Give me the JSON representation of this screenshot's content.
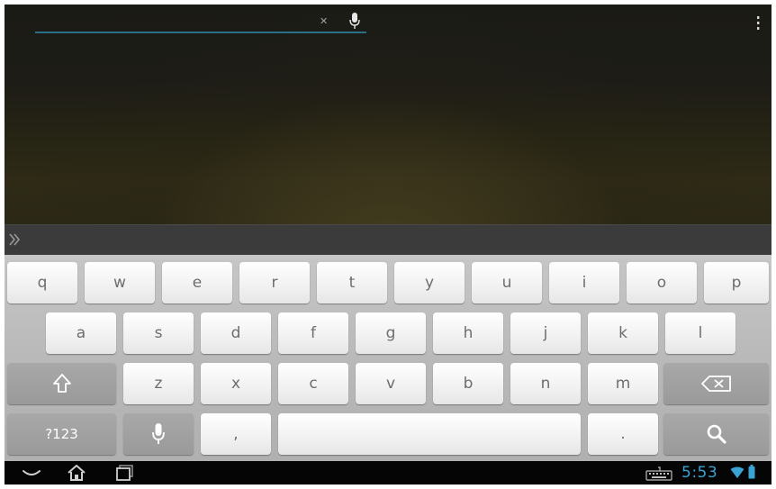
{
  "search": {
    "value": "",
    "placeholder": ""
  },
  "keyboard": {
    "rows": [
      [
        "q",
        "w",
        "e",
        "r",
        "t",
        "y",
        "u",
        "i",
        "o",
        "p"
      ],
      [
        "a",
        "s",
        "d",
        "f",
        "g",
        "h",
        "j",
        "k",
        "l"
      ],
      [
        "z",
        "x",
        "c",
        "v",
        "b",
        "n",
        "m"
      ]
    ],
    "symbols_label": "?123",
    "comma_label": ",",
    "period_label": "."
  },
  "status_bar": {
    "time": "5:53"
  },
  "colors": {
    "accent": "#3aa3d3",
    "search_underline": "#2a6f86",
    "keyboard_bg": "#b9b9b9"
  },
  "icons": [
    "search-clear-icon",
    "voice-search-mic-icon",
    "overflow-menu-icon",
    "suggestion-expand-icon",
    "shift-icon",
    "backspace-icon",
    "keyboard-mic-icon",
    "search-key-icon",
    "back-icon",
    "home-icon",
    "recent-apps-icon",
    "keyboard-status-icon",
    "wifi-icon",
    "battery-icon"
  ]
}
